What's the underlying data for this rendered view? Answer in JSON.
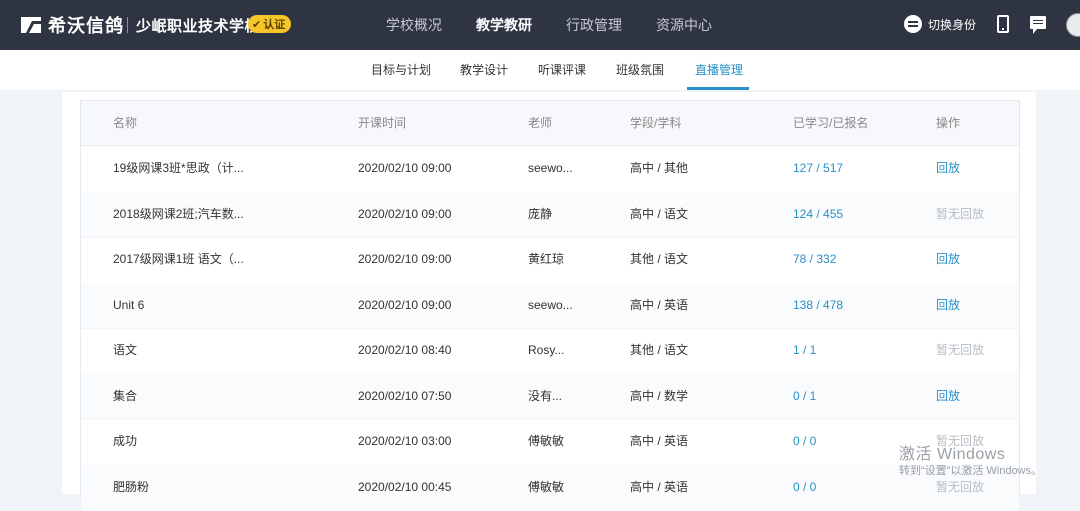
{
  "app": {
    "logo_text": "希沃信鸽",
    "school_name": "少岷职业技术学校",
    "badge_label": "认证",
    "switch_label": "切换身份"
  },
  "nav": [
    "学校概况",
    "教学教研",
    "行政管理",
    "资源中心"
  ],
  "nav_active": "教学教研",
  "subnav": [
    "目标与计划",
    "教学设计",
    "听课评课",
    "班级氛围",
    "直播管理"
  ],
  "subnav_active": "直播管理",
  "table": {
    "headers": [
      "名称",
      "开课时间",
      "老师",
      "学段/学科",
      "已学习/已报名",
      "操作"
    ],
    "rows": [
      [
        "19级网课3班*思政（计...",
        "2020/02/10 09:00",
        "seewo...",
        "高中 / 其他",
        "127 / 517",
        "回放"
      ],
      [
        "2018级网课2班;汽车数...",
        "2020/02/10 09:00",
        "庞静",
        "高中 / 语文",
        "124 / 455",
        "暂无回放"
      ],
      [
        "2017级网课1班 语文（...",
        "2020/02/10 09:00",
        "黄红琼",
        "其他 / 语文",
        "78 / 332",
        "回放"
      ],
      [
        "Unit 6",
        "2020/02/10 09:00",
        "seewo...",
        "高中 / 英语",
        "138 / 478",
        "回放"
      ],
      [
        "语文",
        "2020/02/10 08:40",
        "Rosy...",
        "其他 / 语文",
        "1 / 1",
        "暂无回放"
      ],
      [
        "集合",
        "2020/02/10 07:50",
        "没有...",
        "高中 / 数学",
        "0 / 1",
        "回放"
      ],
      [
        "成功",
        "2020/02/10 03:00",
        "傅敏敏",
        "高中 / 英语",
        "0 / 0",
        "暂无回放"
      ],
      [
        "肥肠粉",
        "2020/02/10 00:45",
        "傅敏敏",
        "高中 / 英语",
        "0 / 0",
        "暂无回放"
      ]
    ]
  },
  "watermark": {
    "line1": "激活 Windows",
    "line2": "转到“设置”以激活 Windows。"
  },
  "colors": {
    "topbar": "#2f3442",
    "accent": "#2a8fc6",
    "badge": "#f5c52a",
    "page_bg": "#f0f4f9"
  }
}
